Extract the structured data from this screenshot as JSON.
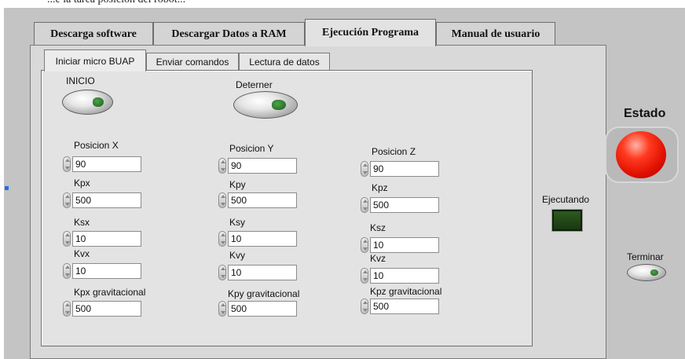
{
  "header_fragment": "...e la tarea posición del robot...",
  "outer_tabs": [
    "Descarga software",
    "Descargar Datos a RAM",
    "Ejecución Programa",
    "Manual de usuario"
  ],
  "inner_tabs": [
    "Iniciar micro BUAP",
    "Enviar comandos",
    "Lectura de datos"
  ],
  "buttons": {
    "inicio": "INICIO",
    "deterner": "Deterner",
    "terminar": "Terminar"
  },
  "status": {
    "title": "Estado",
    "running_label": "Ejecutando"
  },
  "controls": {
    "x": {
      "pos": {
        "label": "Posicion X",
        "value": "90"
      },
      "kp": {
        "label": "Kpx",
        "value": "500"
      },
      "ks": {
        "label": "Ksx",
        "value": "10"
      },
      "kv": {
        "label": "Kvx",
        "value": "10"
      },
      "kg": {
        "label": "Kpx gravitacional",
        "value": "500"
      }
    },
    "y": {
      "pos": {
        "label": "Posicion Y",
        "value": "90"
      },
      "kp": {
        "label": "Kpy",
        "value": "500"
      },
      "ks": {
        "label": "Ksy",
        "value": "10"
      },
      "kv": {
        "label": "Kvy",
        "value": "10"
      },
      "kg": {
        "label": "Kpy gravitacional",
        "value": "500"
      }
    },
    "z": {
      "pos": {
        "label": "Posicion Z",
        "value": "90"
      },
      "kp": {
        "label": "Kpz",
        "value": "500"
      },
      "ks": {
        "label": "Ksz",
        "value": "10"
      },
      "kv": {
        "label": "Kvz",
        "value": "10"
      },
      "kg": {
        "label": "Kpz gravitacional",
        "value": "500"
      }
    }
  }
}
